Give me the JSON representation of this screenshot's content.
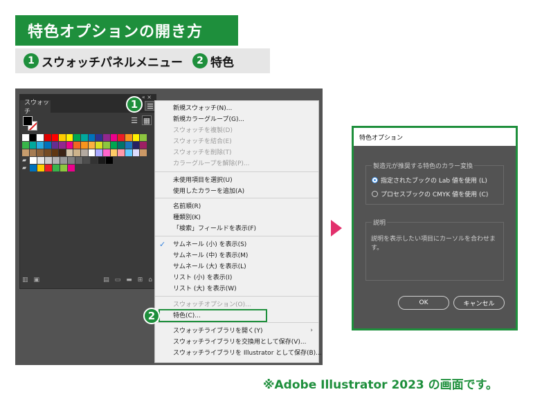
{
  "header": {
    "title": "特色オプションの開き方",
    "step1_num": "1",
    "step1_label": "スウォッチパネルメニュー",
    "step2_num": "2",
    "step2_label": "特色"
  },
  "swatch_panel": {
    "tab_label": "スウォッチ",
    "collapse_glyph": "«  ×",
    "menu_icon": "hamburger-menu-icon"
  },
  "badges": {
    "one": "1",
    "two": "2"
  },
  "menu": {
    "items": [
      {
        "label": "新規スウォッチ(N)...",
        "disabled": false
      },
      {
        "label": "新規カラーグループ(G)...",
        "disabled": false
      },
      {
        "label": "スウォッチを複製(D)",
        "disabled": true
      },
      {
        "label": "スウォッチを結合(E)",
        "disabled": true
      },
      {
        "label": "スウォッチを削除(T)",
        "disabled": true
      },
      {
        "label": "カラーグループを解除(P)...",
        "disabled": true
      },
      {
        "label": "未使用項目を選択(U)",
        "disabled": false
      },
      {
        "label": "使用したカラーを追加(A)",
        "disabled": false
      },
      {
        "label": "名前順(R)",
        "disabled": false
      },
      {
        "label": "種類別(K)",
        "disabled": false
      },
      {
        "label": "「検索」フィールドを表示(F)",
        "disabled": false
      },
      {
        "label": "サムネール (小) を表示(S)",
        "disabled": false,
        "checked": true
      },
      {
        "label": "サムネール (中) を表示(M)",
        "disabled": false
      },
      {
        "label": "サムネール (大) を表示(L)",
        "disabled": false
      },
      {
        "label": "リスト (小) を表示(I)",
        "disabled": false
      },
      {
        "label": "リスト (大) を表示(W)",
        "disabled": false
      },
      {
        "label": "スウォッチオプション(O)...",
        "disabled": true
      },
      {
        "label": "特色(C)...",
        "disabled": false,
        "highlighted": true
      },
      {
        "label": "スウォッチライブラリを開く(Y)",
        "disabled": false,
        "submenu": true
      },
      {
        "label": "スウォッチライブラリを交換用として保存(V)...",
        "disabled": false
      },
      {
        "label": "スウォッチライブラリを Illustrator として保存(B)...",
        "disabled": false
      }
    ],
    "check_glyph": "✓",
    "submenu_glyph": "›"
  },
  "dialog": {
    "title": "特色オプション",
    "group1_label": "製造元が推奨する特色のカラー変換",
    "option1": "指定されたブックの Lab 値を使用 (L)",
    "option2": "プロセスブックの CMYK 値を使用 (C)",
    "selected_option": 1,
    "group2_label": "説明",
    "description": "説明を表示したい項目にカーソルを合わせます。",
    "ok_label": "OK",
    "cancel_label": "キャンセル"
  },
  "footnote": "※Adobe Illustrator 2023 の画面です。",
  "colors": {
    "accent_green": "#1e8f3c",
    "arrow_pink": "#e2306c",
    "ui_dark": "#535353"
  }
}
